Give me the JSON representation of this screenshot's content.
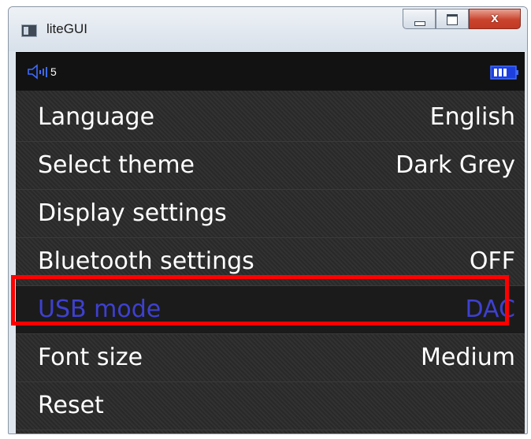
{
  "window": {
    "title": "liteGUI",
    "controls": {
      "minimize": "minimize-icon",
      "maximize": "maximize-icon",
      "close": "x"
    }
  },
  "statusbar": {
    "volume_icon": "speaker-icon",
    "volume": "5",
    "battery_icon": "battery-icon",
    "battery_level": 0.75
  },
  "menu": {
    "items": [
      {
        "label": "Language",
        "value": "English"
      },
      {
        "label": "Select theme",
        "value": "Dark Grey"
      },
      {
        "label": "Display settings",
        "value": ""
      },
      {
        "label": "Bluetooth settings",
        "value": "OFF"
      },
      {
        "label": "USB mode",
        "value": "DAC"
      },
      {
        "label": "Font size",
        "value": "Medium"
      },
      {
        "label": "Reset",
        "value": ""
      }
    ],
    "selected_index": 4
  },
  "colors": {
    "selected_text": "#3e40d0",
    "highlight_box": "#ff0000",
    "screen_background": "#2b2b2b",
    "accent_icon": "#3e6bff"
  }
}
